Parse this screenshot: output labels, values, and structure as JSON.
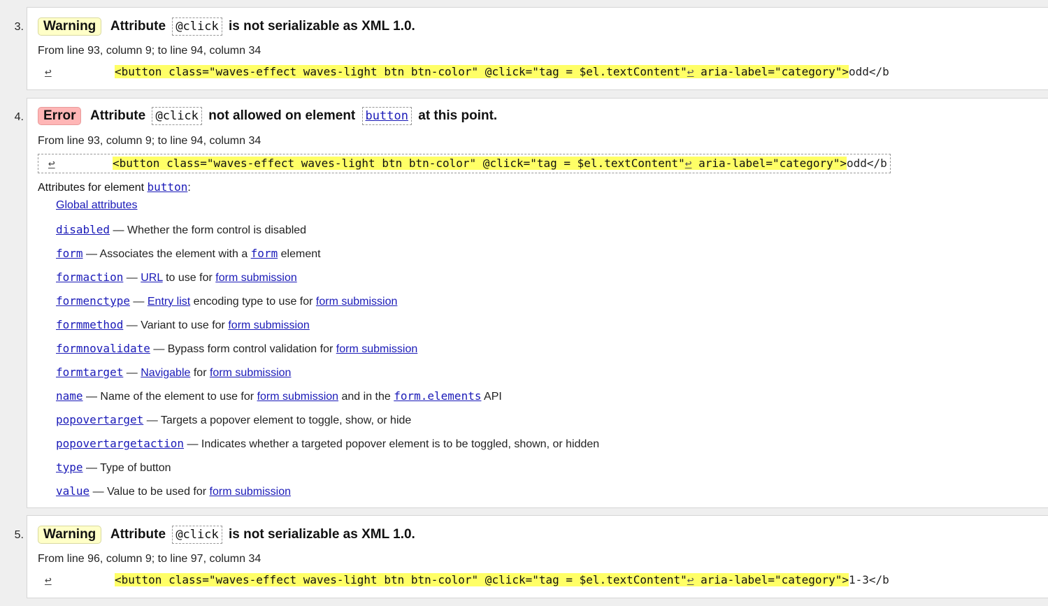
{
  "messages": [
    {
      "number": "3.",
      "type_label": "Warning",
      "pre": "Attribute",
      "code": "@click",
      "post": "is not serializable as XML 1.0.",
      "location": "From line 93, column 9; to line 94, column 34",
      "extract_arrow": "↩",
      "extract_code": "<button class=\"waves-effect waves-light btn btn-color\" @click=\"tag = $el.textContent\"",
      "extract_lf": "↩",
      "extract_code2": "         aria-label=\"category\">",
      "extract_tail": "odd</b"
    },
    {
      "number": "4.",
      "type_label": "Error",
      "pre": "Attribute",
      "code": "@click",
      "mid": "not allowed on element",
      "code2": "button",
      "post": "at this point.",
      "location": "From line 93, column 9; to line 94, column 34",
      "extract_arrow": "↩",
      "extract_code": "<button class=\"waves-effect waves-light btn btn-color\" @click=\"tag = $el.textContent\"",
      "extract_lf": "↩",
      "extract_code2": "         aria-label=\"category\">",
      "extract_tail": "odd</b",
      "attrs_title_pre": "Attributes for element",
      "attrs_title_code": "button",
      "attrs_title_post": ":",
      "attributes": {
        "global": "Global attributes",
        "disabled": {
          "name": "disabled",
          "desc": "— Whether the form control is disabled"
        },
        "form": {
          "name": "form",
          "desc1": "— Associates the element with a",
          "link": "form",
          "desc2": "element"
        },
        "formaction": {
          "name": "formaction",
          "dash": "—",
          "link1": "URL",
          "mid": "to use for",
          "link2": "form submission"
        },
        "formenctype": {
          "name": "formenctype",
          "dash": "—",
          "link1": "Entry list",
          "mid": "encoding type to use for",
          "link2": "form submission"
        },
        "formmethod": {
          "name": "formmethod",
          "mid": "— Variant to use for",
          "link2": "form submission"
        },
        "formnovalidate": {
          "name": "formnovalidate",
          "mid": "— Bypass form control validation for",
          "link2": "form submission"
        },
        "formtarget": {
          "name": "formtarget",
          "dash": "—",
          "link1": "Navigable",
          "mid": "for",
          "link2": "form submission"
        },
        "name": {
          "name": "name",
          "mid": "— Name of the element to use for",
          "link2": "form submission",
          "mid2": "and in the",
          "link3": "form.elements",
          "end": "API"
        },
        "popovertarget": {
          "name": "popovertarget",
          "desc": "— Targets a popover element to toggle, show, or hide"
        },
        "popovertargetaction": {
          "name": "popovertargetaction",
          "desc": "— Indicates whether a targeted popover element is to be toggled, shown, or hidden"
        },
        "type": {
          "name": "type",
          "desc": "— Type of button"
        },
        "value": {
          "name": "value",
          "mid": "— Value to be used for",
          "link2": "form submission"
        }
      }
    },
    {
      "number": "5.",
      "type_label": "Warning",
      "pre": "Attribute",
      "code": "@click",
      "post": "is not serializable as XML 1.0.",
      "location": "From line 96, column 9; to line 97, column 34",
      "extract_arrow": "↩",
      "extract_code": "<button class=\"waves-effect waves-light btn btn-color\" @click=\"tag = $el.textContent\"",
      "extract_lf": "↩",
      "extract_code2": "         aria-label=\"category\">",
      "extract_tail": "1-3</b"
    }
  ]
}
